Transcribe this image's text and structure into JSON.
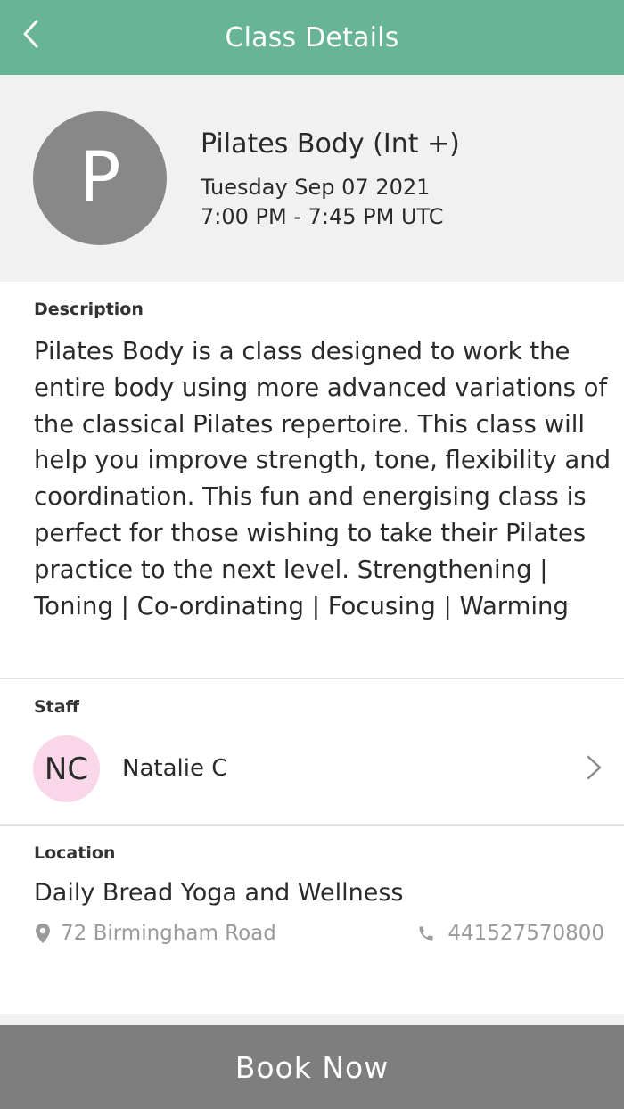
{
  "header": {
    "title": "Class Details",
    "back_icon": "chevron-left-icon",
    "background": "#67b496"
  },
  "class": {
    "avatar_letter": "P",
    "name": "Pilates Body (Int +)",
    "date": "Tuesday Sep 07 2021",
    "time": "7:00 PM - 7:45 PM UTC"
  },
  "description": {
    "label": "Description",
    "text": "Pilates Body is a class designed to work the entire body using more advanced variations of the classical Pilates repertoire. This class will help you improve strength, tone, flexibility and coordination. This fun and energising class is perfect for those wishing to take their Pilates practice to the next level. Strengthening | Toning | Co-ordinating | Focusing | Warming"
  },
  "staff": {
    "label": "Staff",
    "initials": "NC",
    "name": "Natalie C",
    "avatar_color": "#f9d7e8"
  },
  "location": {
    "label": "Location",
    "name": "Daily Bread Yoga and Wellness",
    "address": "72 Birmingham Road",
    "phone": "441527570800",
    "address_icon": "map-pin-icon",
    "phone_icon": "phone-icon"
  },
  "actions": {
    "book_label": "Book Now",
    "book_color": "#7e7e7e"
  }
}
